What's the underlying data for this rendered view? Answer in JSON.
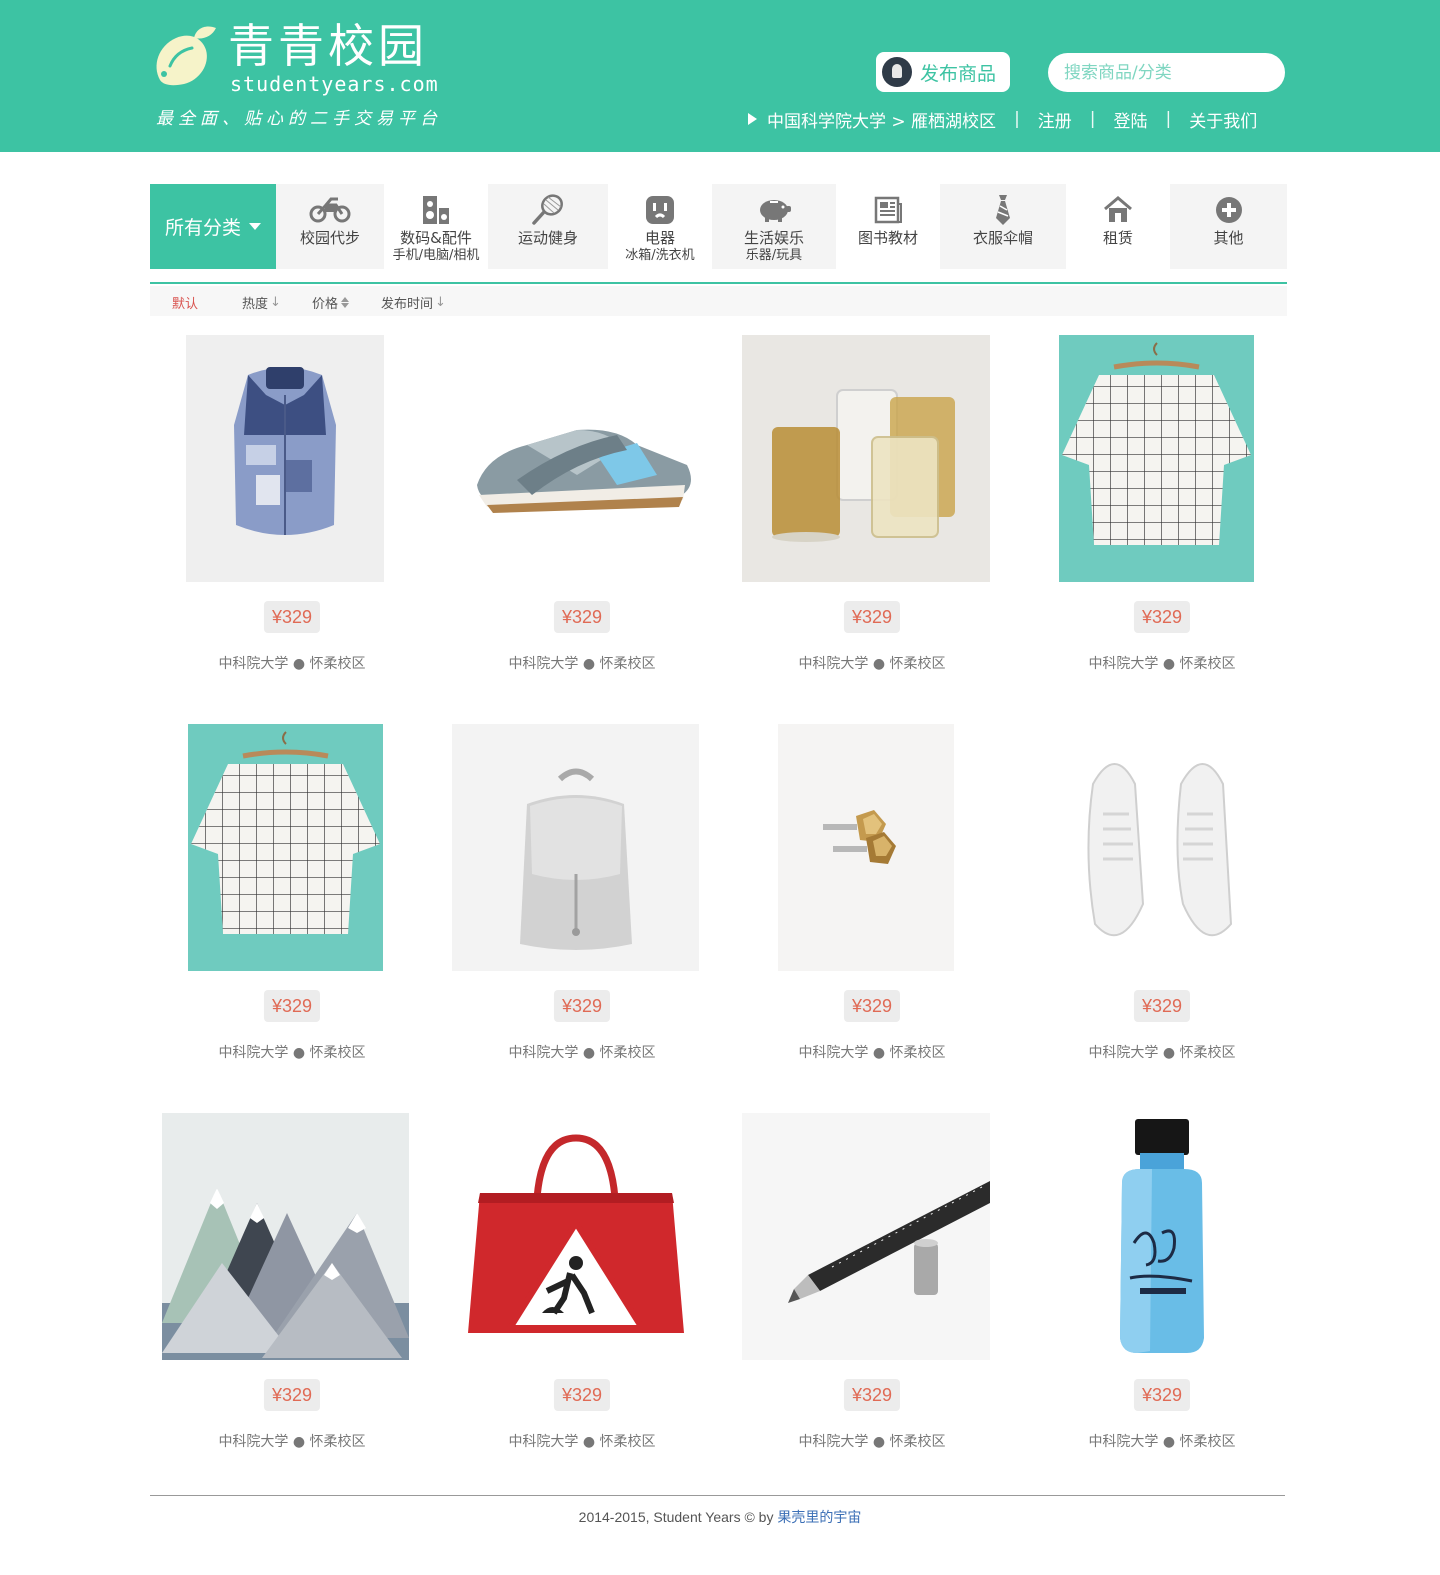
{
  "header": {
    "title": "青青校园",
    "domain": "studentyears.com",
    "slogan": "最全面、贴心的二手交易平台",
    "publish_label": "发布商品",
    "search_placeholder": "搜索商品/分类",
    "campus_path": "中国科学院大学 > 雁栖湖校区",
    "separator": "|",
    "register": "注册",
    "login": "登陆",
    "about": "关于我们"
  },
  "categories": {
    "all_label": "所有分类",
    "items": [
      {
        "label": "校园代步",
        "sub": "",
        "icon": "motorbike-icon"
      },
      {
        "label": "数码&配件",
        "sub": "手机/电脑/相机",
        "icon": "speaker-icon"
      },
      {
        "label": "运动健身",
        "sub": "",
        "icon": "tennis-racket-icon"
      },
      {
        "label": "电器",
        "sub": "冰箱/洗衣机",
        "icon": "power-outlet-icon"
      },
      {
        "label": "生活娱乐",
        "sub": "乐器/玩具",
        "icon": "piggy-bank-icon"
      },
      {
        "label": "图书教材",
        "sub": "",
        "icon": "newspaper-icon"
      },
      {
        "label": "衣服伞帽",
        "sub": "",
        "icon": "necktie-icon"
      },
      {
        "label": "租赁",
        "sub": "",
        "icon": "house-icon"
      },
      {
        "label": "其他",
        "sub": "",
        "icon": "plus-circle-icon"
      }
    ]
  },
  "sort": {
    "default": "默认",
    "hot": "热度",
    "price": "价格",
    "time": "发布时间"
  },
  "products": [
    {
      "price": "¥329",
      "location": "中科院大学 ● 怀柔校区",
      "image": "quilted-vest"
    },
    {
      "price": "¥329",
      "location": "中科院大学 ● 怀柔校区",
      "image": "sneaker"
    },
    {
      "price": "¥329",
      "location": "中科院大学 ● 怀柔校区",
      "image": "glass-cups"
    },
    {
      "price": "¥329",
      "location": "中科院大学 ● 怀柔校区",
      "image": "grid-shirt"
    },
    {
      "price": "¥329",
      "location": "中科院大学 ● 怀柔校区",
      "image": "grid-shirt"
    },
    {
      "price": "¥329",
      "location": "中科院大学 ● 怀柔校区",
      "image": "backpack"
    },
    {
      "price": "¥329",
      "location": "中科院大学 ● 怀柔校区",
      "image": "earrings"
    },
    {
      "price": "¥329",
      "location": "中科院大学 ● 怀柔校区",
      "image": "white-sneakers"
    },
    {
      "price": "¥329",
      "location": "中科院大学 ● 怀柔校区",
      "image": "mountain-pillows"
    },
    {
      "price": "¥329",
      "location": "中科院大学 ● 怀柔校区",
      "image": "red-handbag"
    },
    {
      "price": "¥329",
      "location": "中科院大学 ● 怀柔校区",
      "image": "ruler-pen"
    },
    {
      "price": "¥329",
      "location": "中科院大学 ● 怀柔校区",
      "image": "shampoo-bottle"
    }
  ],
  "footer": {
    "text": "2014-2015, Student Years © by ",
    "link": "果壳里的宇宙"
  },
  "colors": {
    "brand": "#3dc3a3",
    "price": "#e06a55",
    "active_sort": "#d9534f",
    "link": "#3b6fb6"
  }
}
